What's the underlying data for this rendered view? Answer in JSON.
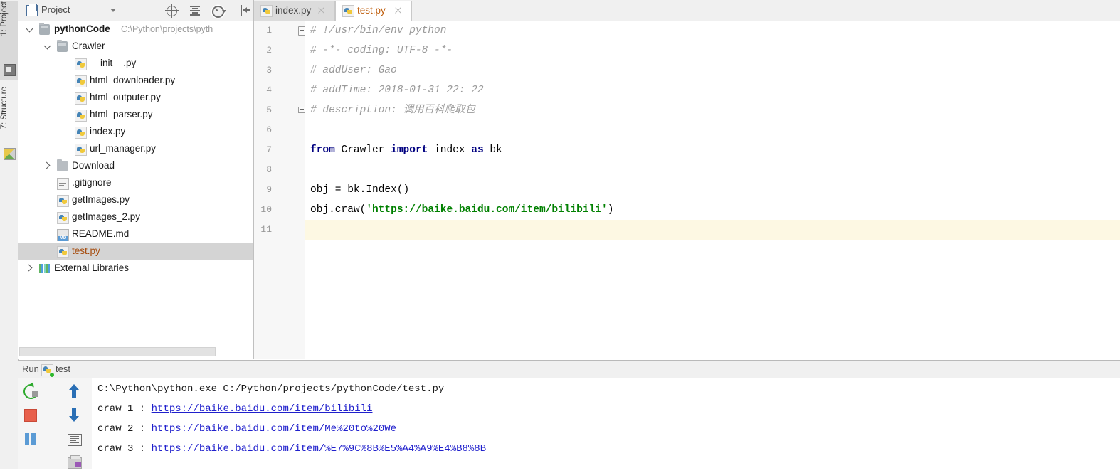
{
  "vertical_tabs": [
    {
      "label": "1: Project",
      "icon": "project-module-icon",
      "active": true
    },
    {
      "label": "7: Structure",
      "icon": "structure-icon",
      "active": false
    }
  ],
  "project_panel": {
    "title": "Project",
    "header_icon": "project-view-icon",
    "caret_icon": "chevron-down-icon",
    "toolbar": [
      {
        "name": "locate-in-tree-button",
        "icon": "target-icon"
      },
      {
        "name": "collapse-all-button",
        "icon": "collapse-all-icon"
      },
      {
        "name": "settings-button",
        "icon": "gear-icon"
      },
      {
        "name": "hide-panel-button",
        "icon": "hide-panel-icon"
      }
    ],
    "tree": [
      {
        "label": "pythonCode",
        "path": "C:\\Python\\projects\\pyth",
        "icon": "folder-open-icon",
        "arrow": "down",
        "indent": 0,
        "bold": true,
        "selected": false
      },
      {
        "label": "Crawler",
        "path": "",
        "icon": "folder-open-icon",
        "arrow": "down",
        "indent": 1,
        "bold": false,
        "selected": false
      },
      {
        "label": "__init__.py",
        "path": "",
        "icon": "python-file-icon",
        "arrow": "",
        "indent": 2,
        "bold": false,
        "selected": false
      },
      {
        "label": "html_downloader.py",
        "path": "",
        "icon": "python-file-icon",
        "arrow": "",
        "indent": 2,
        "bold": false,
        "selected": false
      },
      {
        "label": "html_outputer.py",
        "path": "",
        "icon": "python-file-icon",
        "arrow": "",
        "indent": 2,
        "bold": false,
        "selected": false
      },
      {
        "label": "html_parser.py",
        "path": "",
        "icon": "python-file-icon",
        "arrow": "",
        "indent": 2,
        "bold": false,
        "selected": false
      },
      {
        "label": "index.py",
        "path": "",
        "icon": "python-file-icon",
        "arrow": "",
        "indent": 2,
        "bold": false,
        "selected": false
      },
      {
        "label": "url_manager.py",
        "path": "",
        "icon": "python-file-icon",
        "arrow": "",
        "indent": 2,
        "bold": false,
        "selected": false
      },
      {
        "label": "Download",
        "path": "",
        "icon": "folder-icon",
        "arrow": "right",
        "indent": 1,
        "bold": false,
        "selected": false
      },
      {
        "label": ".gitignore",
        "path": "",
        "icon": "text-file-icon",
        "arrow": "",
        "indent": 1,
        "bold": false,
        "selected": false
      },
      {
        "label": "getImages.py",
        "path": "",
        "icon": "python-file-icon",
        "arrow": "",
        "indent": 1,
        "bold": false,
        "selected": false
      },
      {
        "label": "getImages_2.py",
        "path": "",
        "icon": "python-file-icon",
        "arrow": "",
        "indent": 1,
        "bold": false,
        "selected": false
      },
      {
        "label": "README.md",
        "path": "",
        "icon": "markdown-file-icon",
        "arrow": "",
        "indent": 1,
        "bold": false,
        "selected": false
      },
      {
        "label": "test.py",
        "path": "",
        "icon": "python-file-icon",
        "arrow": "",
        "indent": 1,
        "bold": false,
        "selected": true
      },
      {
        "label": "External Libraries",
        "path": "",
        "icon": "libraries-icon",
        "arrow": "right",
        "indent": 0,
        "bold": false,
        "selected": false
      }
    ]
  },
  "editor": {
    "tabs": [
      {
        "label": "index.py",
        "icon": "python-file-icon",
        "active": false,
        "close_icon": "close-icon"
      },
      {
        "label": "test.py",
        "icon": "python-file-icon",
        "active": true,
        "close_icon": "close-icon"
      }
    ],
    "line_numbers": [
      "1",
      "2",
      "3",
      "4",
      "5",
      "6",
      "7",
      "8",
      "9",
      "10",
      "11"
    ],
    "current_line": 11,
    "lines": [
      {
        "n": 1,
        "tokens": [
          {
            "t": "# !/usr/bin/env python",
            "c": "cm"
          }
        ]
      },
      {
        "n": 2,
        "tokens": [
          {
            "t": "# -*- coding: UTF-8 -*-",
            "c": "cm"
          }
        ]
      },
      {
        "n": 3,
        "tokens": [
          {
            "t": "# addUser: Gao",
            "c": "cm"
          }
        ]
      },
      {
        "n": 4,
        "tokens": [
          {
            "t": "# addTime: 2018-01-31 22: 22",
            "c": "cm"
          }
        ]
      },
      {
        "n": 5,
        "tokens": [
          {
            "t": "# description: 调用百科爬取包",
            "c": "cm"
          }
        ]
      },
      {
        "n": 6,
        "tokens": []
      },
      {
        "n": 7,
        "tokens": [
          {
            "t": "from",
            "c": "kw"
          },
          {
            "t": " Crawler ",
            "c": "pl"
          },
          {
            "t": "import",
            "c": "kw"
          },
          {
            "t": " index ",
            "c": "pl"
          },
          {
            "t": "as",
            "c": "kw"
          },
          {
            "t": " bk",
            "c": "pl"
          }
        ]
      },
      {
        "n": 8,
        "tokens": []
      },
      {
        "n": 9,
        "tokens": [
          {
            "t": "obj = bk.Index()",
            "c": "pl"
          }
        ]
      },
      {
        "n": 10,
        "tokens": [
          {
            "t": "obj.craw(",
            "c": "pl"
          },
          {
            "t": "'https://baike.baidu.com/item/bilibili'",
            "c": "st"
          },
          {
            "t": ")",
            "c": "pl"
          }
        ]
      },
      {
        "n": 11,
        "tokens": []
      }
    ]
  },
  "run_panel": {
    "label": "Run",
    "tab_label": "test",
    "tab_icon": "python-run-config-icon",
    "toolbar_left": [
      {
        "name": "rerun-button",
        "icon": "rerun-icon"
      },
      {
        "name": "stop-button",
        "icon": "stop-icon"
      },
      {
        "name": "pause-button",
        "icon": "pause-icon"
      }
    ],
    "toolbar_right": [
      {
        "name": "up-stacktrace-button",
        "icon": "arrow-up-icon"
      },
      {
        "name": "down-stacktrace-button",
        "icon": "arrow-down-icon"
      },
      {
        "name": "soft-wrap-button",
        "icon": "soft-wrap-icon"
      },
      {
        "name": "print-button",
        "icon": "print-icon"
      }
    ],
    "console": [
      {
        "prefix": "C:\\Python\\python.exe C:/Python/projects/pythonCode/test.py",
        "link": ""
      },
      {
        "prefix": "craw 1 : ",
        "link": "https://baike.baidu.com/item/bilibili"
      },
      {
        "prefix": "craw 2 : ",
        "link": "https://baike.baidu.com/item/Me%20to%20We"
      },
      {
        "prefix": "craw 3 : ",
        "link": "https://baike.baidu.com/item/%E7%9C%8B%E5%A4%A9%E4%B8%8B"
      }
    ]
  },
  "colors": {
    "selection": "#d4d4d4",
    "active_tab_text": "#c06010",
    "keyword": "#000080",
    "string": "#008000",
    "comment": "#9a9a9a",
    "link": "#2020cc",
    "current_line": "#fdf8e3"
  }
}
